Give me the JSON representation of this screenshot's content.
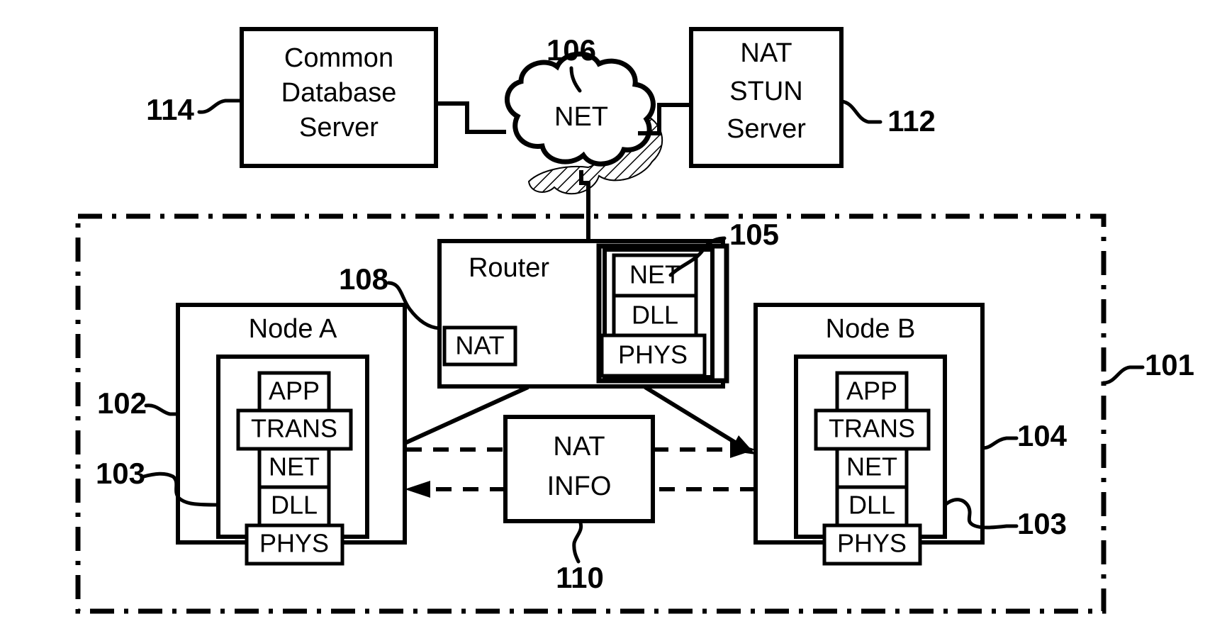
{
  "figure": {
    "title": "NAT traversal network architecture diagram",
    "stroke_color": "#000000",
    "fill_color": "#ffffff",
    "background": "#ffffff"
  },
  "nodes": {
    "common_db_server": {
      "label_line1": "Common",
      "label_line2": "Database",
      "label_line3": "Server",
      "ref": "114"
    },
    "net_cloud": {
      "label": "NET",
      "ref": "106"
    },
    "nat_stun_server": {
      "label_line1": "NAT",
      "label_line2": "STUN",
      "label_line3": "Server",
      "ref": "112"
    },
    "router": {
      "label": "Router",
      "nat_label": "NAT",
      "nat_ref": "108",
      "stack_ref": "105"
    },
    "node_a": {
      "label": "Node A",
      "outer_ref": "102",
      "inner_ref": "103"
    },
    "node_b": {
      "label": "Node B",
      "outer_ref": "104",
      "inner_ref": "103"
    },
    "nat_info": {
      "label_line1": "NAT",
      "label_line2": "INFO",
      "ref": "110"
    },
    "lan_boundary": {
      "ref": "101"
    }
  },
  "stacks": {
    "node_layers": [
      "APP",
      "TRANS",
      "NET",
      "DLL",
      "PHYS"
    ],
    "router_layers": [
      "NET",
      "DLL",
      "PHYS"
    ]
  },
  "refs": {
    "r101": "101",
    "r102": "102",
    "r103_left": "103",
    "r103_right": "103",
    "r104": "104",
    "r105": "105",
    "r106": "106",
    "r108": "108",
    "r110": "110",
    "r112": "112",
    "r114": "114"
  }
}
